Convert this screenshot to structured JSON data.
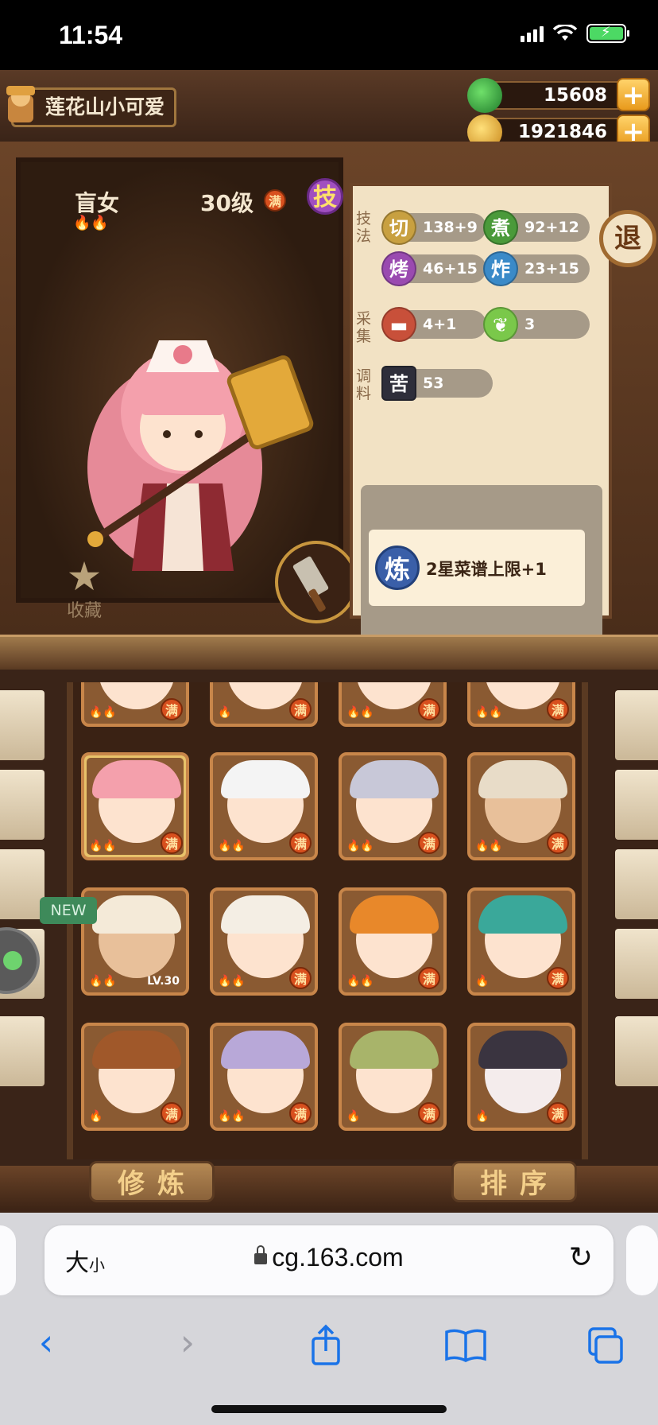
{
  "status_bar": {
    "time": "11:54"
  },
  "player": {
    "name": "莲花山小可爱"
  },
  "currency": {
    "jade": "15608",
    "coins": "1921846"
  },
  "exit_label": "退",
  "character": {
    "name": "盲女",
    "level": "30级",
    "full_badge": "满",
    "skill_btn": "技",
    "collect_label": "收藏"
  },
  "stats": {
    "technique_label": "技法",
    "gather_label": "采集",
    "seasoning_label": "调料",
    "cut": {
      "icon": "切",
      "value": "138+9"
    },
    "boil": {
      "icon": "煮",
      "value": "92+12"
    },
    "roast": {
      "icon": "烤",
      "value": "46+15"
    },
    "fry": {
      "icon": "炸",
      "value": "23+15"
    },
    "meat": {
      "value": "4+1"
    },
    "veg": {
      "value": "3"
    },
    "bitter": {
      "icon": "苦",
      "value": "53"
    },
    "trait": {
      "icon": "炼",
      "text": "2星菜谱上限+1"
    }
  },
  "grid": {
    "full_badge": "满",
    "new_tag": "NEW",
    "lv_label": "LV.30"
  },
  "bottom": {
    "train": "修炼",
    "sort": "排序"
  },
  "browser": {
    "size_big": "大",
    "size_small": "小",
    "url": "cg.163.com"
  },
  "colors": {
    "accent": "#1a73e8",
    "wood": "#6b4428",
    "panel": "#f2e2c4"
  }
}
